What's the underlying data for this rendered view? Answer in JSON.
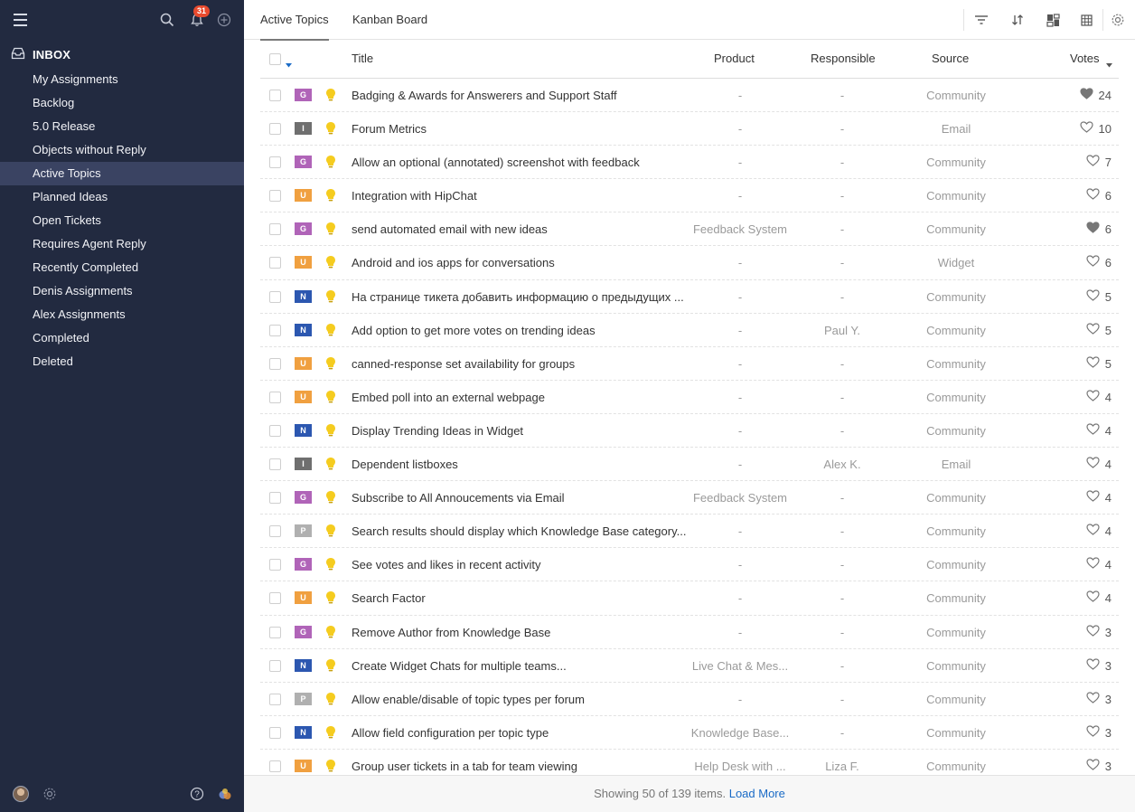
{
  "sidebar": {
    "notifications_count": "31",
    "inbox_label": "INBOX",
    "active_index": 4,
    "items": [
      {
        "label": "My Assignments"
      },
      {
        "label": "Backlog"
      },
      {
        "label": "5.0 Release"
      },
      {
        "label": "Objects without Reply"
      },
      {
        "label": "Active Topics"
      },
      {
        "label": "Planned Ideas"
      },
      {
        "label": "Open Tickets"
      },
      {
        "label": "Requires Agent Reply"
      },
      {
        "label": "Recently Completed"
      },
      {
        "label": "Denis Assignments"
      },
      {
        "label": "Alex Assignments"
      },
      {
        "label": "Completed"
      },
      {
        "label": "Deleted"
      }
    ]
  },
  "tabs": [
    {
      "label": "Active Topics"
    },
    {
      "label": "Kanban Board"
    }
  ],
  "table": {
    "headers": {
      "title": "Title",
      "product": "Product",
      "responsible": "Responsible",
      "source": "Source",
      "votes": "Votes"
    },
    "type_colors": {
      "G": "#b064b8",
      "I": "#6f6f6f",
      "U": "#f0a040",
      "N": "#2c57b0",
      "P": "#b0b0b0"
    },
    "rows": [
      {
        "type": "G",
        "title": "Badging & Awards for Answerers and Support Staff",
        "product": "-",
        "responsible": "-",
        "source": "Community",
        "votes": "24",
        "liked": true
      },
      {
        "type": "I",
        "title": "Forum Metrics",
        "product": "-",
        "responsible": "-",
        "source": "Email",
        "votes": "10",
        "liked": false
      },
      {
        "type": "G",
        "title": "Allow an optional (annotated) screenshot with feedback",
        "product": "-",
        "responsible": "-",
        "source": "Community",
        "votes": "7",
        "liked": false
      },
      {
        "type": "U",
        "title": "Integration with HipChat",
        "product": "-",
        "responsible": "-",
        "source": "Community",
        "votes": "6",
        "liked": false
      },
      {
        "type": "G",
        "title": "send automated email with new ideas",
        "product": "Feedback System",
        "responsible": "-",
        "source": "Community",
        "votes": "6",
        "liked": true
      },
      {
        "type": "U",
        "title": "Android and ios apps for conversations",
        "product": "-",
        "responsible": "-",
        "source": "Widget",
        "votes": "6",
        "liked": false
      },
      {
        "type": "N",
        "title": "На странице тикета добавить информацию о предыдущих ...",
        "product": "-",
        "responsible": "-",
        "source": "Community",
        "votes": "5",
        "liked": false
      },
      {
        "type": "N",
        "title": "Add option to get more votes on trending ideas",
        "product": "-",
        "responsible": "Paul Y.",
        "source": "Community",
        "votes": "5",
        "liked": false
      },
      {
        "type": "U",
        "title": "canned-response set availability for groups",
        "product": "-",
        "responsible": "-",
        "source": "Community",
        "votes": "5",
        "liked": false
      },
      {
        "type": "U",
        "title": "Embed poll into an external webpage",
        "product": "-",
        "responsible": "-",
        "source": "Community",
        "votes": "4",
        "liked": false
      },
      {
        "type": "N",
        "title": "Display Trending Ideas in Widget",
        "product": "-",
        "responsible": "-",
        "source": "Community",
        "votes": "4",
        "liked": false
      },
      {
        "type": "I",
        "title": "Dependent listboxes",
        "product": "-",
        "responsible": "Alex K.",
        "source": "Email",
        "votes": "4",
        "liked": false
      },
      {
        "type": "G",
        "title": "Subscribe to All Annoucements via Email",
        "product": "Feedback System",
        "responsible": "-",
        "source": "Community",
        "votes": "4",
        "liked": false
      },
      {
        "type": "P",
        "title": "Search results should display which Knowledge Base category...",
        "product": "-",
        "responsible": "-",
        "source": "Community",
        "votes": "4",
        "liked": false
      },
      {
        "type": "G",
        "title": "See votes and likes in recent activity",
        "product": "-",
        "responsible": "-",
        "source": "Community",
        "votes": "4",
        "liked": false
      },
      {
        "type": "U",
        "title": "Search Factor",
        "product": "-",
        "responsible": "-",
        "source": "Community",
        "votes": "4",
        "liked": false
      },
      {
        "type": "G",
        "title": "Remove Author from Knowledge Base",
        "product": "-",
        "responsible": "-",
        "source": "Community",
        "votes": "3",
        "liked": false
      },
      {
        "type": "N",
        "title": "Create Widget Chats for multiple teams...",
        "product": "Live Chat & Mes...",
        "responsible": "-",
        "source": "Community",
        "votes": "3",
        "liked": false
      },
      {
        "type": "P",
        "title": "Allow enable/disable of topic types per forum",
        "product": "-",
        "responsible": "-",
        "source": "Community",
        "votes": "3",
        "liked": false
      },
      {
        "type": "N",
        "title": "Allow field configuration per topic type",
        "product": "Knowledge Base...",
        "responsible": "-",
        "source": "Community",
        "votes": "3",
        "liked": false
      },
      {
        "type": "U",
        "title": "Group user tickets in a tab for team viewing",
        "product": "Help Desk with ...",
        "responsible": "Liza F.",
        "source": "Community",
        "votes": "3",
        "liked": false
      }
    ]
  },
  "footer": {
    "showing_text": "Showing 50 of 139 items.",
    "load_more": "Load More"
  }
}
